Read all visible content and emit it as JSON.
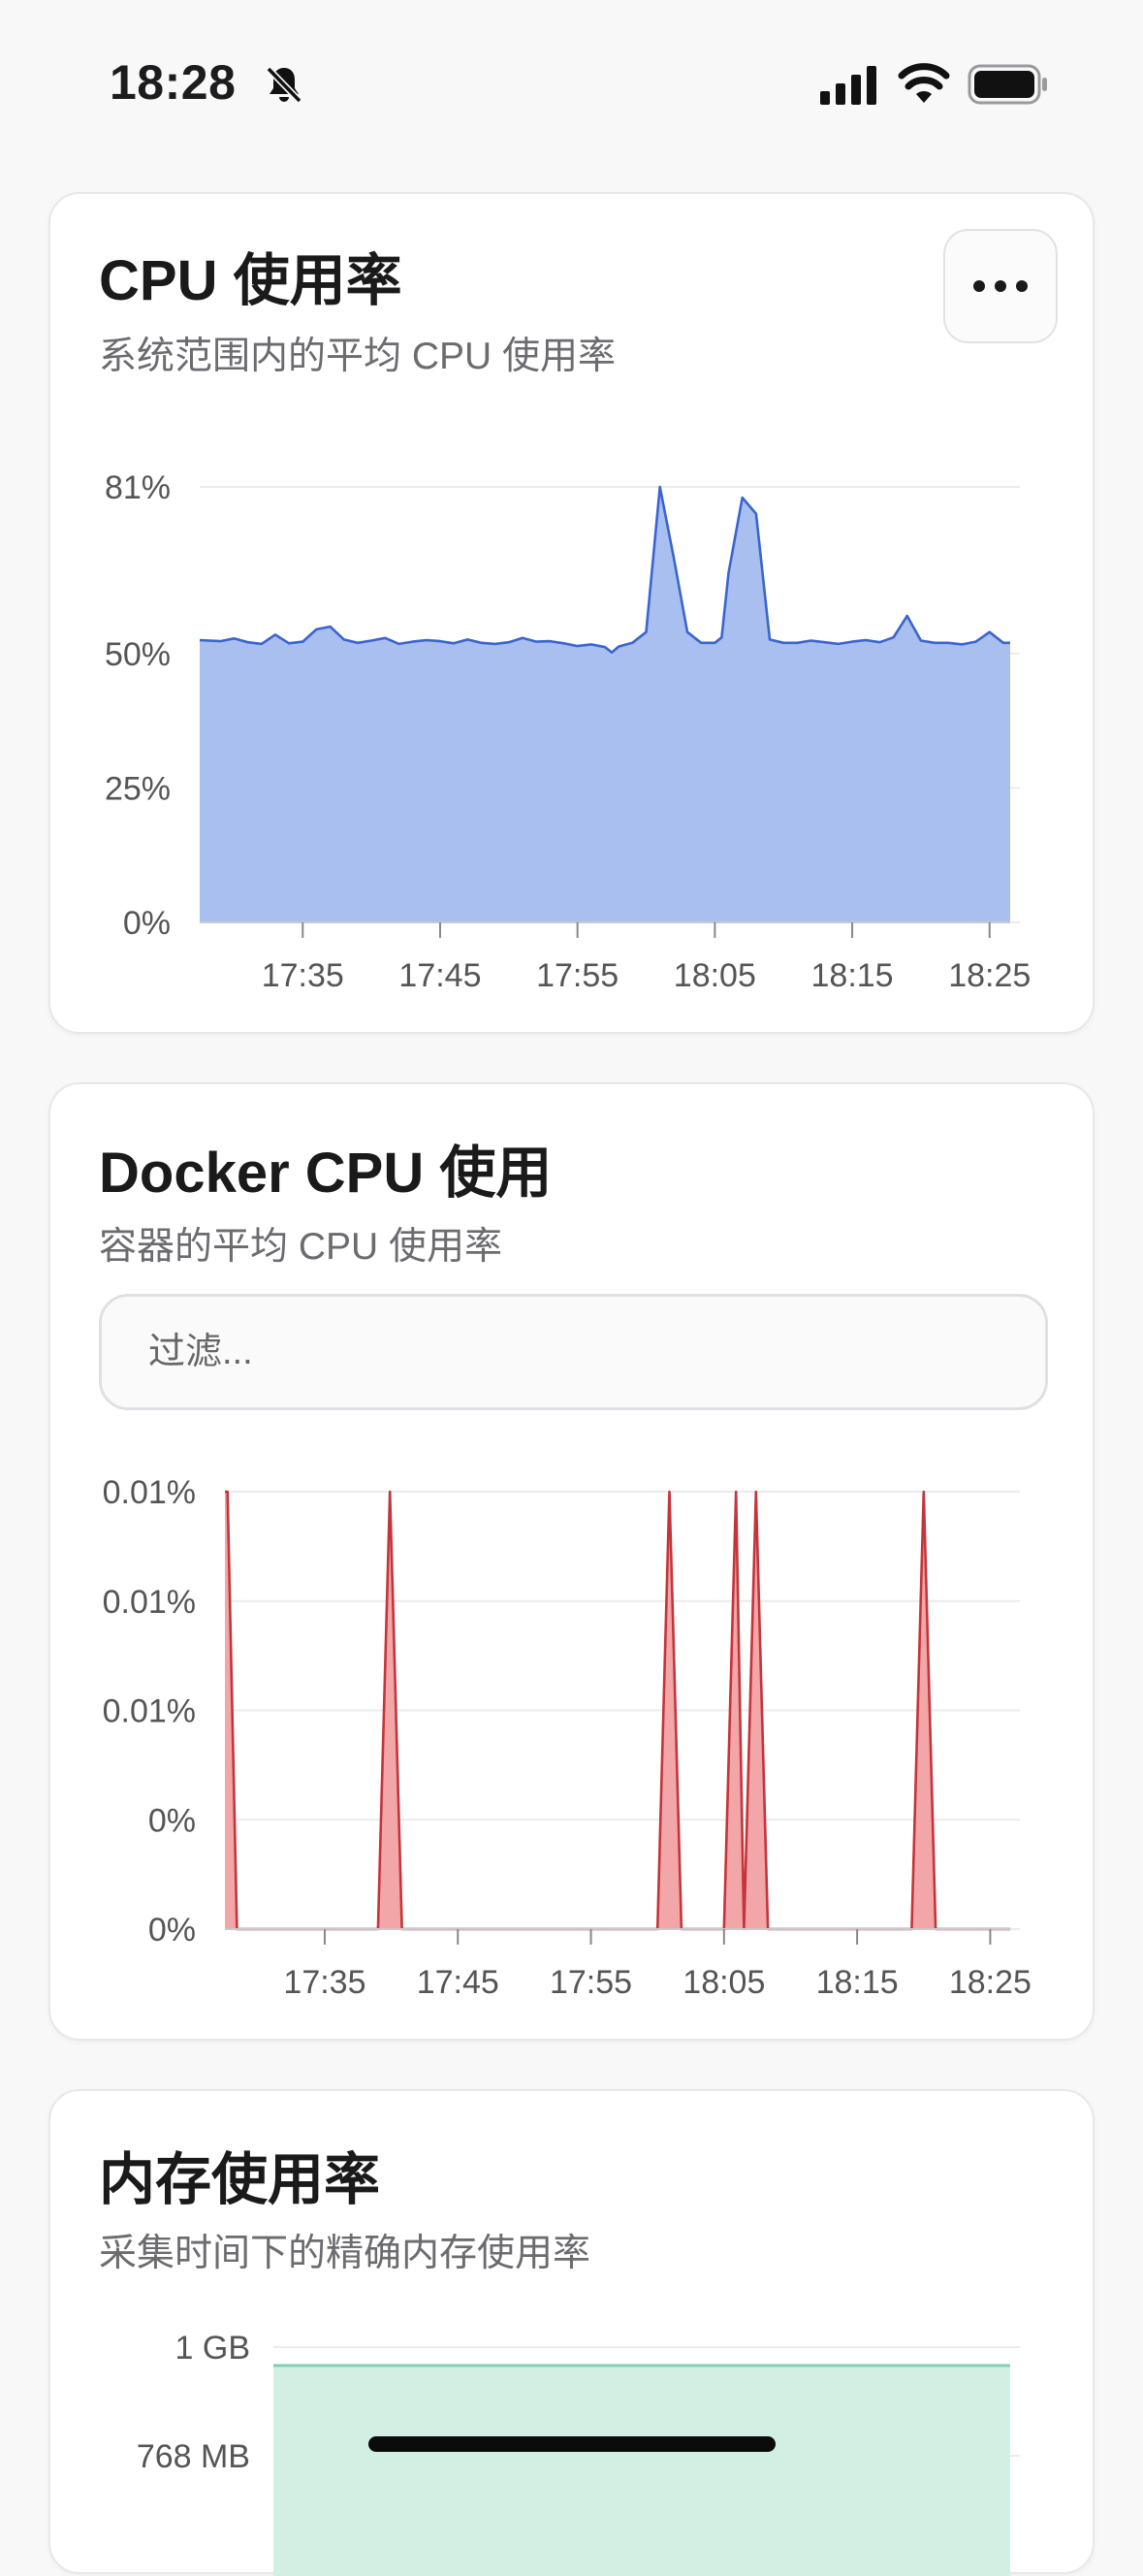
{
  "status_bar": {
    "time": "18:28",
    "icons": [
      "bell-slash-icon",
      "cellular-signal-icon",
      "wifi-icon",
      "battery-icon"
    ]
  },
  "cards": [
    {
      "title": "CPU 使用率",
      "subtitle": "系统范围内的平均 CPU 使用率",
      "menu_icon": "ellipsis-icon",
      "color": "#3a64d0",
      "fill": "#a8bff0"
    },
    {
      "title": "Docker CPU 使用",
      "subtitle": "容器的平均 CPU 使用率",
      "filter_placeholder": "过滤...",
      "color": "#c4343b",
      "fill": "#f2a6a8"
    },
    {
      "title": "内存使用率",
      "subtitle": "采集时间下的精确内存使用率",
      "color": "#7fd0b4",
      "fill": "#d2efe4"
    }
  ],
  "chart_data": [
    {
      "type": "area",
      "x_tick_labels": [
        "17:35",
        "17:45",
        "17:55",
        "18:05",
        "18:15",
        "18:25"
      ],
      "x_ticks_minutes": [
        5,
        15,
        25,
        35,
        45,
        55
      ],
      "x_range_minutes": [
        -2.5,
        56.5
      ],
      "y_tick_labels": [
        "0%",
        "25%",
        "50%",
        "81%"
      ],
      "y_tick_values": [
        0,
        25,
        50,
        81
      ],
      "ylim": [
        0,
        81
      ],
      "grid": true,
      "series": [
        {
          "x": [
            -2.5,
            -1,
            0,
            1,
            2,
            3,
            4,
            5,
            6,
            7,
            8,
            9,
            10,
            11,
            12,
            13,
            14,
            15,
            16,
            17,
            18,
            19,
            20,
            21,
            22,
            23,
            24,
            25,
            26,
            27,
            27.5,
            28,
            29,
            30,
            31,
            32,
            33,
            34,
            35,
            35.5,
            36,
            37,
            38,
            39,
            40,
            41,
            42,
            43,
            44,
            45,
            46,
            47,
            48,
            49,
            50,
            51,
            52,
            53,
            54,
            55,
            56,
            56.5
          ],
          "y": [
            52.5,
            52.3,
            52.8,
            52.1,
            51.8,
            53.5,
            51.9,
            52.2,
            54.5,
            55,
            52.6,
            52,
            52.4,
            52.9,
            51.8,
            52.2,
            52.5,
            52.3,
            51.9,
            52.6,
            52.0,
            51.8,
            52.1,
            52.9,
            52.2,
            52.3,
            51.9,
            51.4,
            51.7,
            51.2,
            50.2,
            51.3,
            52.0,
            54.0,
            81,
            68,
            54,
            52,
            52,
            53,
            65,
            79,
            76,
            52.6,
            52,
            52,
            52.4,
            52.1,
            51.8,
            52.2,
            52.5,
            52.1,
            53,
            57,
            52.4,
            52,
            52,
            51.7,
            52.2,
            54.0,
            52,
            52
          ]
        }
      ]
    },
    {
      "type": "area",
      "x_tick_labels": [
        "17:35",
        "17:45",
        "17:55",
        "18:05",
        "18:15",
        "18:25"
      ],
      "x_ticks_minutes": [
        5,
        15,
        25,
        35,
        45,
        55
      ],
      "x_range_minutes": [
        -2.5,
        56.5
      ],
      "y_tick_labels": [
        "0%",
        "0%",
        "0.01%",
        "0.01%",
        "0.01%"
      ],
      "ylim": [
        0,
        0.008
      ],
      "grid": true,
      "series": [
        {
          "x": [
            -2.5,
            -2.3,
            -1.6,
            9,
            9.9,
            10.8,
            30,
            30.9,
            31.8,
            35,
            35.9,
            36.5,
            37.4,
            38.3,
            49.1,
            50,
            50.9,
            56.5
          ],
          "y": [
            0.008,
            0.008,
            0,
            0,
            0.008,
            0,
            0,
            0.008,
            0,
            0,
            0.008,
            0,
            0.008,
            0,
            0,
            0.008,
            0,
            0
          ]
        }
      ]
    },
    {
      "type": "area",
      "y_tick_labels": [
        "768 MB",
        "1 GB"
      ],
      "y_tick_values_mb": [
        768,
        1024
      ],
      "grid": true,
      "series": [
        {
          "x": [
            0,
            1
          ],
          "y": [
            1000,
            1000
          ]
        }
      ]
    }
  ]
}
